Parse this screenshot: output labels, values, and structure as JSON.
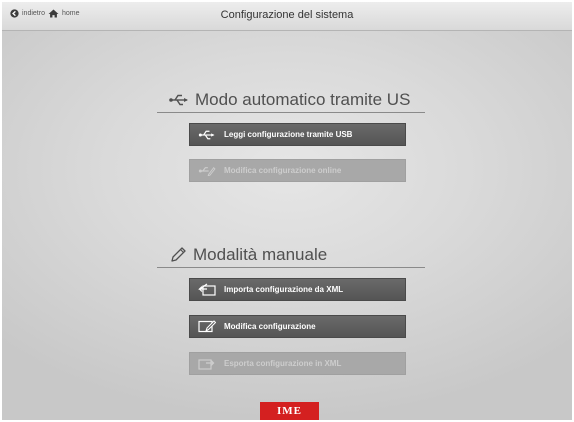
{
  "header": {
    "back_label": "indietro",
    "home_label": "home",
    "title": "Configurazione del sistema"
  },
  "sections": {
    "usb": {
      "title": "Modo automatico tramite US",
      "icon": "usb-icon",
      "actions": [
        {
          "label": "Leggi configurazione tramite USB",
          "icon": "usb-icon",
          "enabled": true
        },
        {
          "label": "Modifica configurazione online",
          "icon": "usb-edit-icon",
          "enabled": false
        }
      ]
    },
    "manual": {
      "title": "Modalità manuale",
      "icon": "pencil-icon",
      "actions": [
        {
          "label": "Importa configurazione da XML",
          "icon": "import-icon",
          "enabled": true
        },
        {
          "label": "Modifica configurazione",
          "icon": "edit-icon",
          "enabled": true
        },
        {
          "label": "Esporta configurazione in XML",
          "icon": "export-icon",
          "enabled": false
        }
      ]
    }
  },
  "footer": {
    "logo_text": "IME"
  },
  "colors": {
    "button_enabled": "#5c5c5c",
    "button_disabled": "#a8a8a8",
    "logo": "#d42020"
  }
}
